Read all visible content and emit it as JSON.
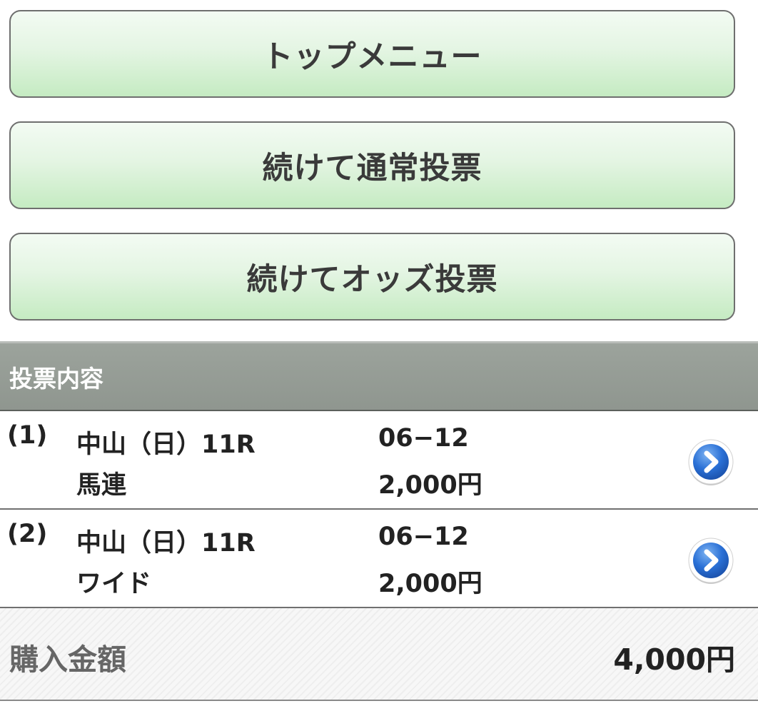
{
  "buttons": {
    "top_menu": "トップメニュー",
    "continue_normal": "続けて通常投票",
    "continue_odds": "続けてオッズ投票"
  },
  "section": {
    "title": "投票内容"
  },
  "bets": [
    {
      "index": "(1)",
      "race": "中山（日）11R",
      "type": "馬連",
      "combination": "06−12",
      "amount": "2,000円"
    },
    {
      "index": "(2)",
      "race": "中山（日）11R",
      "type": "ワイド",
      "combination": "06−12",
      "amount": "2,000円"
    }
  ],
  "total": {
    "label": "購入金額",
    "value": "4,000円"
  },
  "icons": {
    "detail": "chevron-right-circle-icon"
  },
  "colors": {
    "button_border": "#6f6f6f",
    "button_fill": "#e4f5e3",
    "header_bg": "#8f968f",
    "chevron_blue": "#2a70d6"
  }
}
